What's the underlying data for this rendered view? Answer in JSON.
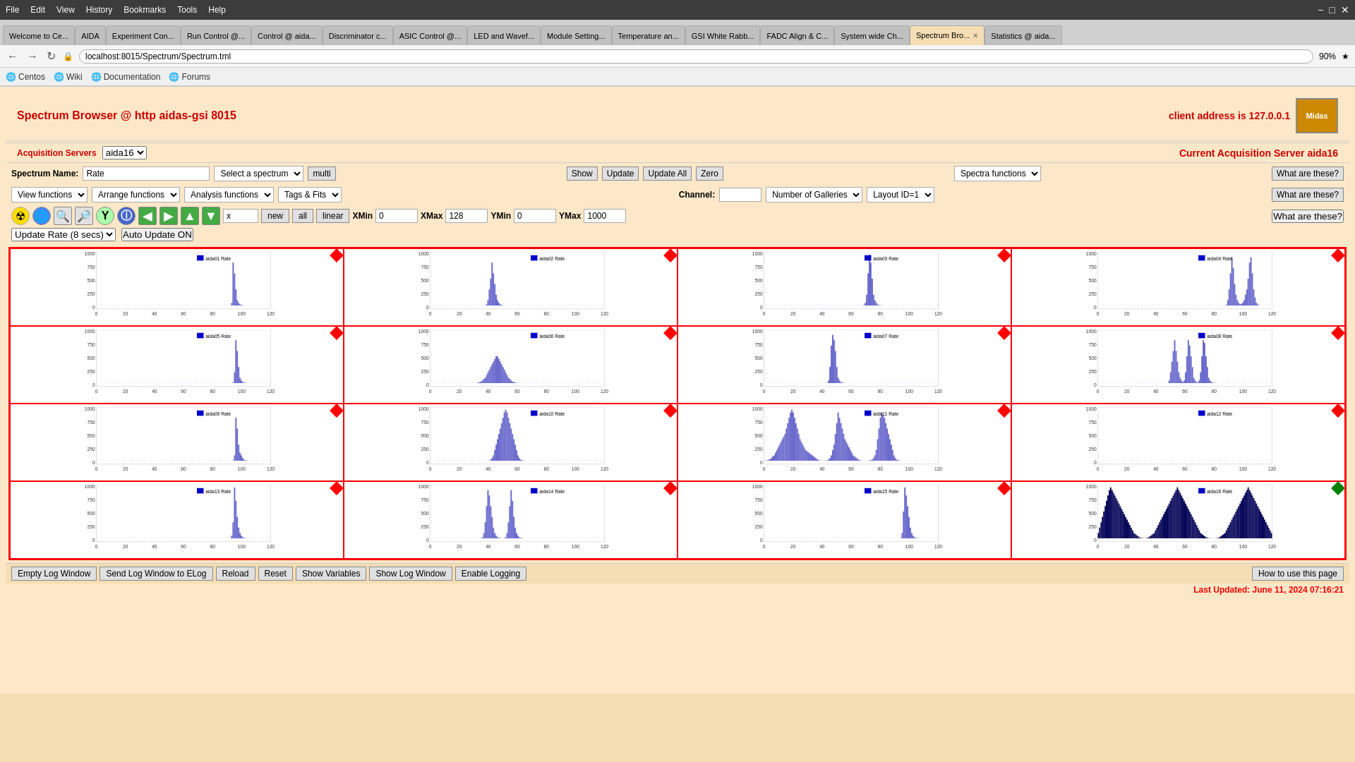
{
  "browser": {
    "title": "Spectrum Browser",
    "address": "localhost:8015/Spectrum/Spectrum.tml",
    "zoom": "90%",
    "tabs": [
      {
        "label": "Welcome to Ce...",
        "id": "welcome"
      },
      {
        "label": "AIDA",
        "id": "aida"
      },
      {
        "label": "Experiment Con...",
        "id": "exp"
      },
      {
        "label": "Run Control @...",
        "id": "run"
      },
      {
        "label": "Control @ aida...",
        "id": "ctrl"
      },
      {
        "label": "Discriminator c...",
        "id": "disc"
      },
      {
        "label": "ASIC Control @...",
        "id": "asic"
      },
      {
        "label": "LED and Wavef...",
        "id": "led"
      },
      {
        "label": "Module Setting...",
        "id": "module"
      },
      {
        "label": "Temperature an...",
        "id": "temp"
      },
      {
        "label": "GSI White Rabb...",
        "id": "gsi"
      },
      {
        "label": "FADC Align & C...",
        "id": "fadc"
      },
      {
        "label": "System wide Ch...",
        "id": "sys"
      },
      {
        "label": "Spectrum Bro...",
        "id": "spectrum",
        "active": true
      },
      {
        "label": "Statistics @ aida...",
        "id": "stats"
      }
    ],
    "bookmarks": [
      {
        "label": "Centos",
        "icon": "globe"
      },
      {
        "label": "Wiki",
        "icon": "globe"
      },
      {
        "label": "Documentation",
        "icon": "globe"
      },
      {
        "label": "Forums",
        "icon": "globe"
      }
    ]
  },
  "page": {
    "title": "Spectrum Browser @ http aidas-gsi 8015",
    "client_address_label": "client address is 127.0.0.1",
    "acquisition_label": "Acquisition Servers",
    "acquisition_server_value": "aida16",
    "current_acq_label": "Current Acquisition Server aida16"
  },
  "controls": {
    "spectrum_name_label": "Spectrum Name:",
    "spectrum_name_value": "Rate",
    "spectrum_select_placeholder": "Select a spectrum",
    "multi_btn": "multi",
    "show_btn": "Show",
    "update_btn": "Update",
    "update_all_btn": "Update All",
    "zero_btn": "Zero",
    "spectra_functions_label": "Spectra functions",
    "what_are_these1": "What are these?",
    "view_functions_label": "View functions",
    "arrange_functions_label": "Arrange functions",
    "analysis_functions_label": "Analysis functions",
    "tags_fits_label": "Tags & Fits",
    "channel_label": "Channel:",
    "channel_value": "",
    "number_of_galleries_label": "Number of Galleries",
    "layout_id_label": "Layout ID=1",
    "what_are_these2": "What are these?",
    "what_are_these3": "What are these?",
    "toolbar": {
      "x_input": "x",
      "new_btn": "new",
      "all_btn": "all",
      "linear_btn": "linear",
      "xmin_label": "XMin",
      "xmin_value": "0",
      "xmax_label": "XMax",
      "xmax_value": "128",
      "ymin_label": "YMin",
      "ymin_value": "0",
      "ymax_label": "YMax",
      "ymax_value": "1000"
    },
    "update_rate_label": "Update Rate (8 secs)",
    "auto_update_label": "Auto Update ON"
  },
  "galleries": [
    {
      "id": 1,
      "label": "aida01 Rate",
      "diamond": "red"
    },
    {
      "id": 2,
      "label": "aida02 Rate",
      "diamond": "red"
    },
    {
      "id": 3,
      "label": "aida03 Rate",
      "diamond": "red"
    },
    {
      "id": 4,
      "label": "aida04 Rate",
      "diamond": "red"
    },
    {
      "id": 5,
      "label": "aida05 Rate",
      "diamond": "red"
    },
    {
      "id": 6,
      "label": "aida06 Rate",
      "diamond": "red"
    },
    {
      "id": 7,
      "label": "aida07 Rate",
      "diamond": "red"
    },
    {
      "id": 8,
      "label": "aida08 Rate",
      "diamond": "red"
    },
    {
      "id": 9,
      "label": "aida09 Rate",
      "diamond": "red"
    },
    {
      "id": 10,
      "label": "aida10 Rate",
      "diamond": "red"
    },
    {
      "id": 11,
      "label": "aida11 Rate",
      "diamond": "red"
    },
    {
      "id": 12,
      "label": "aida12 Rate",
      "diamond": "red"
    },
    {
      "id": 13,
      "label": "aida13 Rate",
      "diamond": "red"
    },
    {
      "id": 14,
      "label": "aida14 Rate",
      "diamond": "red"
    },
    {
      "id": 15,
      "label": "aida15 Rate",
      "diamond": "red"
    },
    {
      "id": 16,
      "label": "aida16 Rate",
      "diamond": "green"
    }
  ],
  "bottom": {
    "buttons": [
      "Empty Log Window",
      "Send Log Window to ELog",
      "Reload",
      "Reset",
      "Show Variables",
      "Show Log Window",
      "Enable Logging"
    ],
    "how_to_use": "How to use this page",
    "last_updated": "Last Updated: June 11, 2024 07:16:21"
  }
}
